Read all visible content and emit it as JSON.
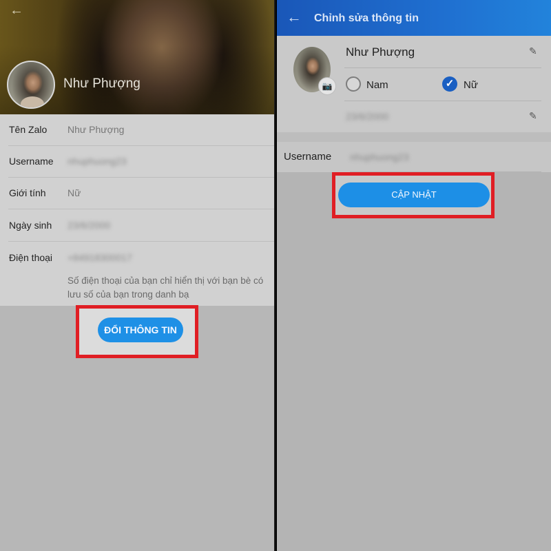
{
  "left": {
    "cover_name": "Như Phượng",
    "rows": [
      {
        "label": "Tên Zalo",
        "value": "Như Phượng",
        "blurred": false
      },
      {
        "label": "Username",
        "value": "nhuphuong23",
        "blurred": true
      },
      {
        "label": "Giới tính",
        "value": "Nữ",
        "blurred": false
      },
      {
        "label": "Ngày sinh",
        "value": "23/6/2000",
        "blurred": true
      },
      {
        "label": "Điện thoại",
        "value": "+84918300017",
        "blurred": true
      }
    ],
    "phone_note": "Số điện thoại của bạn chỉ hiển thị với bạn bè có lưu số của bạn trong danh bạ",
    "change_button": "ĐỔI THÔNG TIN"
  },
  "right": {
    "header_title": "Chỉnh sửa thông tin",
    "name": "Như Phượng",
    "gender_options": [
      {
        "label": "Nam",
        "checked": false
      },
      {
        "label": "Nữ",
        "checked": true
      }
    ],
    "dob": "23/6/2000",
    "username_label": "Username",
    "username_value": "nhuphuong23",
    "update_button": "CẬP NHẬT"
  },
  "icons": {
    "back": "arrow-left-icon",
    "edit": "pencil-icon",
    "camera": "camera-icon",
    "check": "check-icon"
  },
  "colors": {
    "header_blue": "#1f6fd0",
    "button_blue": "#1e90e6",
    "highlight_red": "#e01e24",
    "check_blue": "#1a5fc2"
  }
}
